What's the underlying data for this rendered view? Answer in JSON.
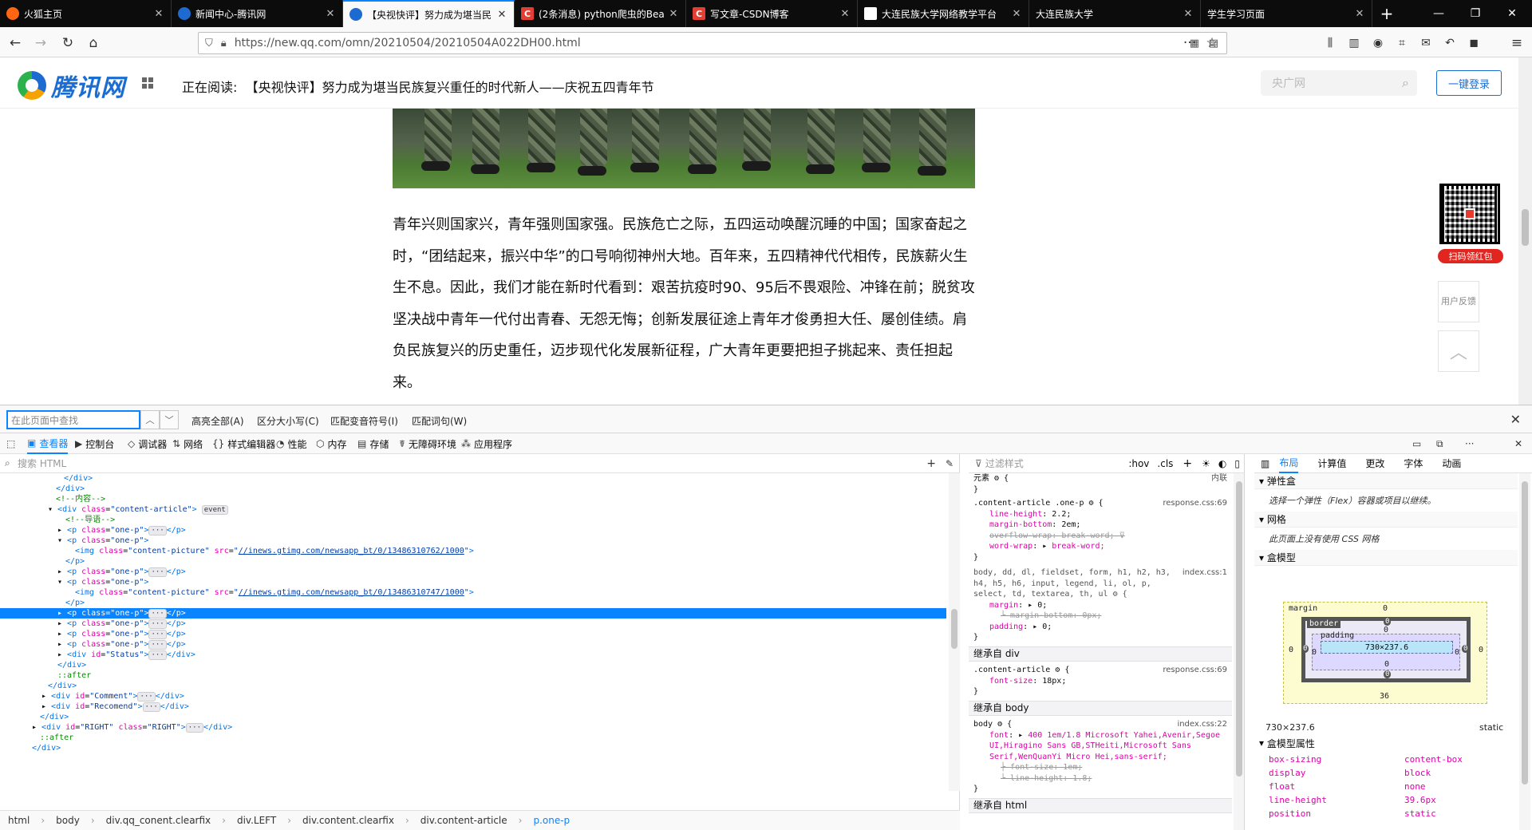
{
  "browser": {
    "tabs": [
      {
        "label": "火狐主页",
        "favicon": "firefox-icon",
        "color": "#ff6611",
        "active": false
      },
      {
        "label": "新闻中心-腾讯网",
        "favicon": "tencent-icon",
        "color": "#1d6ad0",
        "active": false
      },
      {
        "label": "【央视快评】努力成为堪当民",
        "favicon": "tencent-icon",
        "color": "#1d6ad0",
        "active": true
      },
      {
        "label": "(2条消息) python爬虫的Bea",
        "favicon": "csdn-icon",
        "color": "#e33e33",
        "active": false
      },
      {
        "label": "写文章-CSDN博客",
        "favicon": "csdn-icon",
        "color": "#e33e33",
        "active": false
      },
      {
        "label": "大连民族大学网络教学平台",
        "favicon": "page-icon",
        "color": "#ffffff",
        "active": false
      },
      {
        "label": "大连民族大学",
        "favicon": "none",
        "color": "#0c0c0d",
        "active": false
      },
      {
        "label": "学生学习页面",
        "favicon": "none",
        "color": "#0c0c0d",
        "active": false
      }
    ],
    "url": "https://new.qq.com/omn/20210504/20210504A022DH00.html"
  },
  "site": {
    "logo_text": "腾讯网",
    "reading_label": "正在阅读:",
    "reading_title": "【央视快评】努力成为堪当民族复兴重任的时代新人——庆祝五四青年节",
    "search_placeholder": "央广网",
    "login_button": "一键登录",
    "article_text": "青年兴则国家兴，青年强则国家强。民族危亡之际，五四运动唤醒沉睡的中国；国家奋起之时，“团结起来，振兴中华”的口号响彻神州大地。百年来，五四精神代代相传，民族薪火生生不息。因此，我们才能在新时代看到：艰苦抗疫时90、95后不畏艰险、冲锋在前；脱贫攻坚决战中青年一代付出青春、无怨无悔；创新发展征途上青年才俊勇担大任、屡创佳绩。肩负民族复兴的历史重任，迈步现代化发展新征程，广大青年更要把担子挑起来、责任担起来。",
    "qr_badge": "扫码领红包",
    "feedback_label": "用户反馈"
  },
  "findbar": {
    "placeholder": "在此页面中查找",
    "highlight_all": "高亮全部(A)",
    "match_case": "区分大小写(C)",
    "match_diacritics": "匹配变音符号(I)",
    "whole_words": "匹配词句(W)"
  },
  "devtools": {
    "tabs": [
      "查看器",
      "控制台",
      "调试器",
      "网络",
      "样式编辑器",
      "性能",
      "内存",
      "存储",
      "无障碍环境",
      "应用程序"
    ],
    "search_html": "搜索 HTML",
    "breadcrumbs": [
      "html",
      "body",
      "div.qq_conent.clearfix",
      "div.LEFT",
      "div.content.clearfix",
      "div.content-article",
      "p.one-p"
    ],
    "rules_filter": "过滤样式",
    "rules_toggles": [
      ":hov",
      ".cls"
    ],
    "rules": {
      "element_label": "元素",
      "element_source": "内联",
      "rule1_selector": ".content-article .one-p",
      "rule1_file": "response.css:69",
      "rule1_props": [
        {
          "name": "line-height",
          "value": "2.2;"
        },
        {
          "name": "margin-bottom",
          "value": "2em;"
        },
        {
          "name": "overflow-wrap",
          "value": "break-word;"
        },
        {
          "name": "word-wrap",
          "value": "break-word;"
        }
      ],
      "rule2_selector": "body, dd, dl, fieldset, form, h1, h2, h3, h4, h5, h6, input, legend, li, ol, p, select, td, textarea, th, ul",
      "rule2_file": "index.css:1",
      "rule2_props": [
        {
          "name": "margin",
          "value": "0;"
        },
        {
          "name": "margin-bottom",
          "value": "0px;"
        },
        {
          "name": "padding",
          "value": "0;"
        }
      ],
      "inherit_div": "继承自 div",
      "rule3_selector": ".content-article",
      "rule3_file": "response.css:69",
      "rule3_props": [
        {
          "name": "font-size",
          "value": "18px;"
        }
      ],
      "inherit_body": "继承自 body",
      "rule4_selector": "body",
      "rule4_file": "index.css:22",
      "rule4_font_name": "font",
      "rule4_font_value": "400 1em/1.8 Microsoft Yahei,Avenir,Segoe UI,Hiragino Sans GB,STHeiti,Microsoft Sans Serif,WenQuanYi Micro Hei,sans-serif;",
      "rule4_props": [
        {
          "name": "font-size",
          "value": "1em;"
        },
        {
          "name": "line-height",
          "value": "1.8;"
        }
      ],
      "inherit_html": "继承自 html"
    },
    "layout_tabs": [
      "布局",
      "计算值",
      "更改",
      "字体",
      "动画"
    ],
    "flexbox_title": "弹性盒",
    "flexbox_note": "选择一个弹性（Flex）容器或项目以继续。",
    "grid_title": "网格",
    "grid_note": "此页面上没有使用 CSS 网格",
    "boxmodel_title": "盒模型",
    "boxmodel": {
      "margin_label": "margin",
      "border_label": "border",
      "padding_label": "padding",
      "content": "730×237.6",
      "margin_top": "0",
      "margin_bottom": "36",
      "margin_left": "0",
      "margin_right": "0",
      "border_top": "0",
      "border_bottom": "0",
      "border_left": "0",
      "border_right": "0",
      "padding_top": "0",
      "padding_bottom": "0",
      "padding_left": "0",
      "padding_right": "0"
    },
    "dimensions": "730×237.6",
    "position_value": "static",
    "boxmodel_props_title": "盒模型属性",
    "boxmodel_props": [
      {
        "name": "box-sizing",
        "value": "content-box"
      },
      {
        "name": "display",
        "value": "block"
      },
      {
        "name": "float",
        "value": "none"
      },
      {
        "name": "line-height",
        "value": "39.6px"
      },
      {
        "name": "position",
        "value": "static"
      }
    ]
  }
}
